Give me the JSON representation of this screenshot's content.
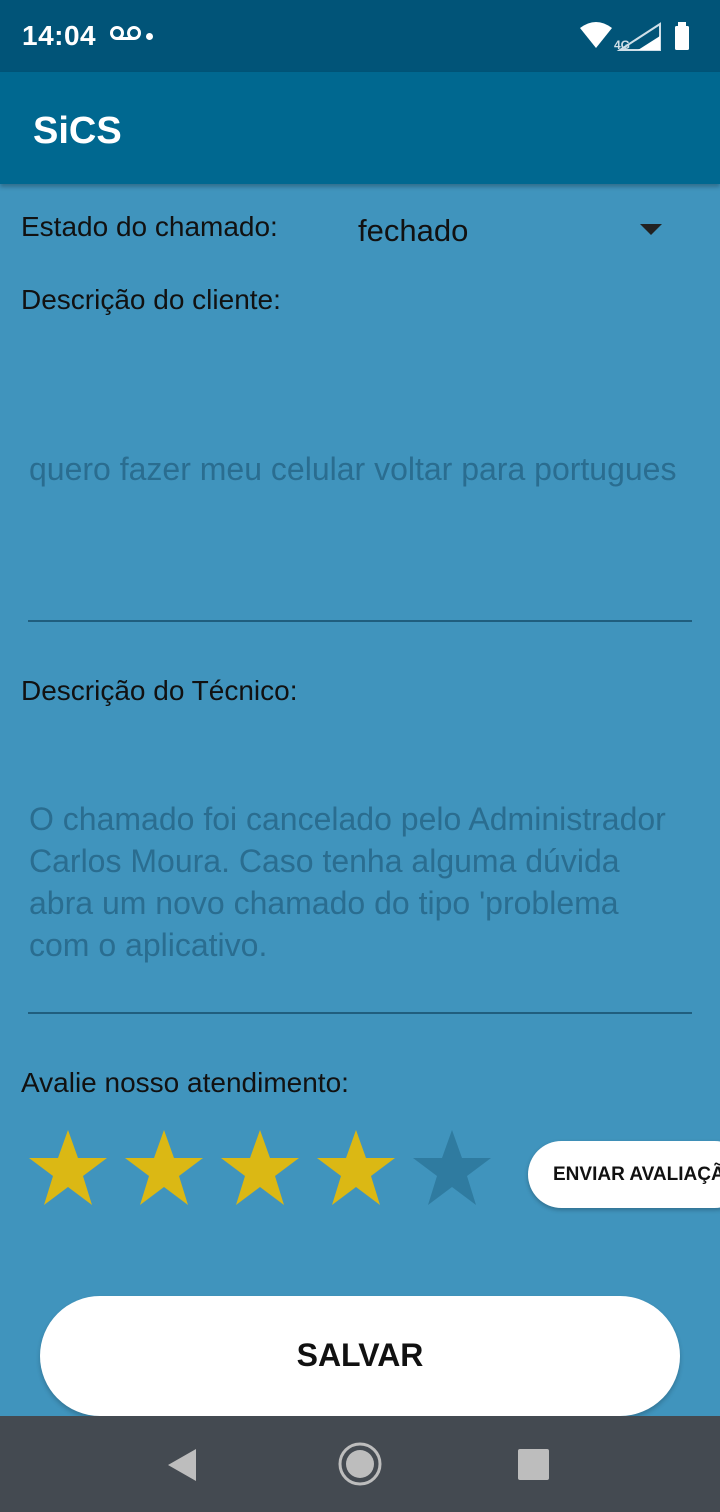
{
  "status_bar": {
    "time": "14:04",
    "network": "4G",
    "icons": [
      "voicemail-icon",
      "notification-dot",
      "wifi-icon",
      "cell-signal-icon",
      "battery-icon"
    ]
  },
  "app_bar": {
    "title": "SiCS"
  },
  "form": {
    "state_label": "Estado do chamado:",
    "state_value": "fechado",
    "client_desc_label": "Descrição do cliente:",
    "client_desc_text": "quero fazer meu celular voltar para portugues",
    "tech_desc_label": "Descrição do Técnico:",
    "tech_desc_text": "O chamado foi cancelado pelo Administrador Carlos Moura. Caso tenha alguma dúvida abra um novo chamado do tipo 'problema com o aplicativo.",
    "rating_label": "Avalie nosso atendimento:",
    "rating": {
      "value": 4,
      "max": 5
    },
    "send_rating_button": "ENVIAR AVALIAÇÃO",
    "save_button": "SALVAR"
  },
  "colors": {
    "background": "#4094bd",
    "status_bar": "#015478",
    "app_bar": "#006890",
    "star_filled": "#dbb814",
    "star_empty": "#2f7ba0",
    "hint_text": "#2a6d90",
    "nav_bar": "#444a51"
  }
}
